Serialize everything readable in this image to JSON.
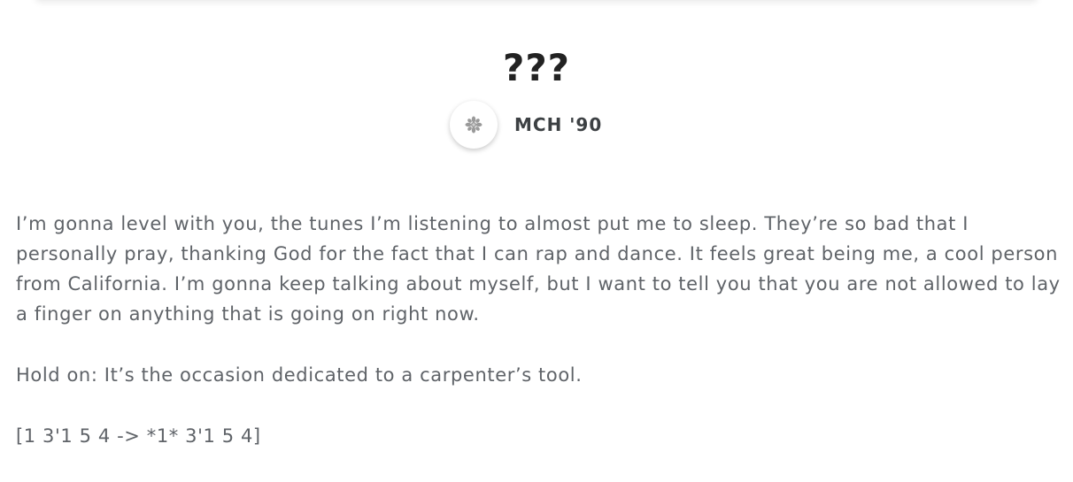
{
  "post": {
    "title": "???",
    "author": {
      "name": "MCH '90",
      "avatar_icon": "flower-avatar-icon"
    },
    "paragraphs": [
      "I’m gonna level with you, the tunes I’m listening to almost put me to sleep. They’re so bad that I personally pray, thanking God for the fact that I can rap and dance. It feels great being me, a cool person from California. I’m gonna keep talking about myself, but I want to tell you that you are not allowed to lay a finger on anything that is going on right now.",
      "Hold on: It’s the occasion dedicated to a carpenter’s tool.",
      "[1 3'1 5 4 -> *1* 3'1 5 4]"
    ]
  }
}
